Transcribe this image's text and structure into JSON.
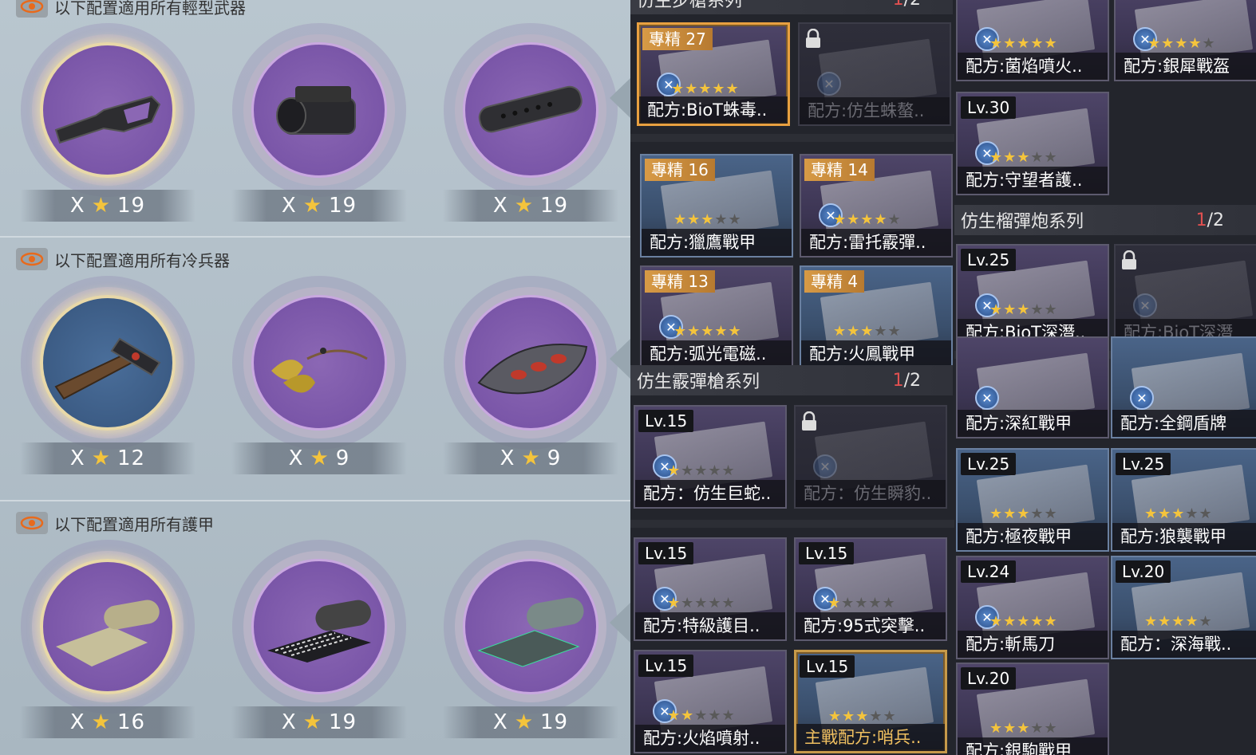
{
  "left": {
    "sections": [
      {
        "title": "以下配置適用所有輕型武器",
        "slots": [
          {
            "x": "X",
            "count": "19",
            "item": "stock-icon",
            "selected": true
          },
          {
            "x": "X",
            "count": "19",
            "item": "scope-icon",
            "selected": false
          },
          {
            "x": "X",
            "count": "19",
            "item": "silencer-icon",
            "selected": false
          }
        ]
      },
      {
        "title": "以下配置適用所有冷兵器",
        "slots": [
          {
            "x": "X",
            "count": "12",
            "item": "hilt-icon",
            "selected": true
          },
          {
            "x": "X",
            "count": "9",
            "item": "tassel-icon",
            "selected": false
          },
          {
            "x": "X",
            "count": "9",
            "item": "guard-icon",
            "selected": false
          }
        ]
      },
      {
        "title": "以下配置適用所有護甲",
        "slots": [
          {
            "x": "X",
            "count": "16",
            "item": "cloth-roll-icon",
            "selected": true
          },
          {
            "x": "X",
            "count": "19",
            "item": "fiber-roll-icon",
            "selected": false
          },
          {
            "x": "X",
            "count": "19",
            "item": "hex-roll-icon",
            "selected": false
          }
        ]
      }
    ]
  },
  "mid": {
    "series1": {
      "title": "仿生步槍系列",
      "cur": "1",
      "total": "/2"
    },
    "series2": {
      "title": "仿生霰彈槍系列",
      "cur": "1",
      "total": "/2"
    },
    "cards": {
      "c1": {
        "badge": "專精 27",
        "label": "配方:BioT蛛毒..",
        "stars": 5
      },
      "c2": {
        "badge": "",
        "label": "配方:仿生蛛螯..",
        "stars": 0
      },
      "c3": {
        "badge": "專精 16",
        "label": "配方:獵鷹戰甲",
        "stars": 3
      },
      "c4": {
        "badge": "專精 14",
        "label": "配方:雷托霰彈..",
        "stars": 4
      },
      "c5": {
        "badge": "專精 13",
        "label": "配方:弧光電磁..",
        "stars": 5
      },
      "c6": {
        "badge": "專精 4",
        "label": "配方:火鳳戰甲",
        "stars": 3
      },
      "c7": {
        "badge": "Lv.15",
        "label": "配方：仿生巨蛇..",
        "stars": 1
      },
      "c8": {
        "badge": "",
        "label": "配方：仿生瞬豹..",
        "stars": 0
      },
      "c9": {
        "badge": "Lv.15",
        "label": "配方:特級護目..",
        "stars": 1
      },
      "c10": {
        "badge": "Lv.15",
        "label": "配方:95式突擊..",
        "stars": 1
      },
      "c11": {
        "badge": "Lv.15",
        "label": "配方:火焰噴射..",
        "stars": 2
      },
      "c12": {
        "badge": "Lv.15",
        "label": "主戰配方:哨兵..",
        "stars": 3
      }
    }
  },
  "right": {
    "series": {
      "title": "仿生榴彈炮系列",
      "cur": "1",
      "total": "/2"
    },
    "cards": {
      "r1": {
        "badge": "",
        "label": "配方:菌焰噴火..",
        "stars": 5
      },
      "r2": {
        "badge": "",
        "label": "配方:銀犀戰盔",
        "stars": 4
      },
      "r3": {
        "badge": "Lv.30",
        "label": "配方:守望者護..",
        "stars": 3
      },
      "r4": {
        "badge": "Lv.25",
        "label": "配方:BioT深潛..",
        "stars": 3
      },
      "r5": {
        "badge": "",
        "label": "配方:BioT深潛",
        "stars": 0
      },
      "r6": {
        "badge": "",
        "label": "配方:深紅戰甲",
        "stars": 0
      },
      "r7": {
        "badge": "",
        "label": "配方:全鋼盾牌",
        "stars": 0
      },
      "r8": {
        "badge": "Lv.25",
        "label": "配方:極夜戰甲",
        "stars": 3
      },
      "r9": {
        "badge": "Lv.25",
        "label": "配方:狼襲戰甲",
        "stars": 3
      },
      "r10": {
        "badge": "Lv.24",
        "label": "配方:斬馬刀",
        "stars": 5
      },
      "r11": {
        "badge": "Lv.20",
        "label": "配方：深海戰..",
        "stars": 4
      },
      "r12": {
        "badge": "Lv.20",
        "label": "配方:銀駒戰甲",
        "stars": 3
      }
    }
  },
  "colors": {
    "accent_gold": "#f4c43c",
    "count_red": "#e05050",
    "selected_border": "#e8a040"
  }
}
